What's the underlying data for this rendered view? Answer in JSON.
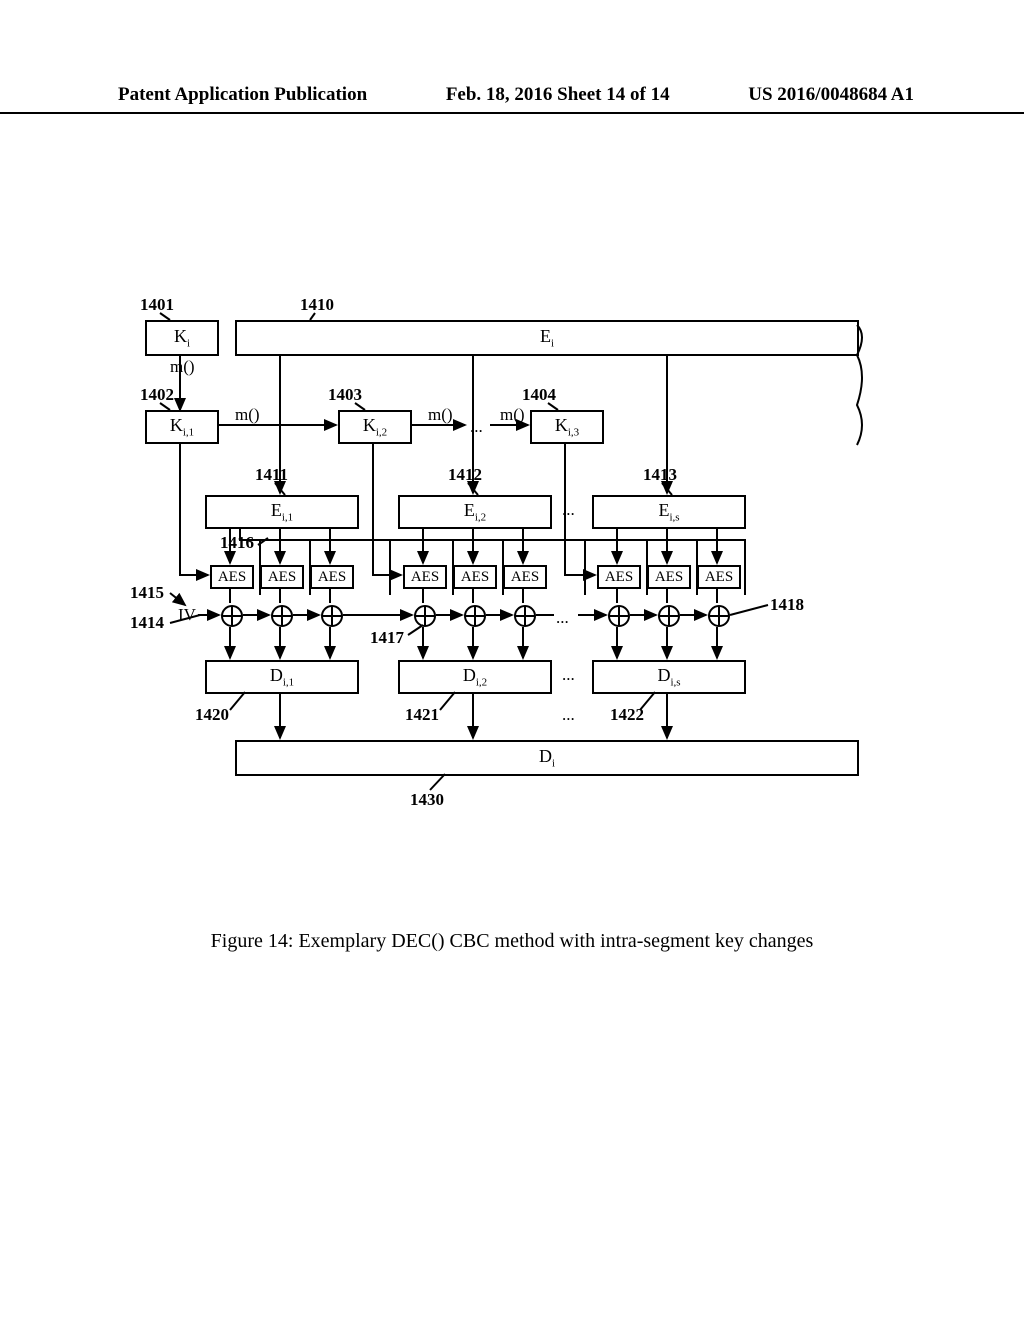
{
  "header": {
    "left": "Patent Application Publication",
    "center": "Feb. 18, 2016  Sheet 14 of 14",
    "right": "US 2016/0048684 A1"
  },
  "labels": {
    "n1401": "1401",
    "n1410": "1410",
    "n1402": "1402",
    "n1403": "1403",
    "n1404": "1404",
    "n1411": "1411",
    "n1412": "1412",
    "n1413": "1413",
    "n1414": "1414",
    "n1415": "1415",
    "n1416": "1416",
    "n1417": "1417",
    "n1418": "1418",
    "n1420": "1420",
    "n1421": "1421",
    "n1422": "1422",
    "n1430": "1430",
    "m": "m()",
    "iv": "IV",
    "dots": "...",
    "aes": "AES"
  },
  "boxes": {
    "Ki": "K<sub class='sub'>i</sub>",
    "Ei": "E<sub class='sub'>i</sub>",
    "Ki1": "K<sub class='sub'>i,1</sub>",
    "Ki2": "K<sub class='sub'>i,2</sub>",
    "Ki3": "K<sub class='sub'>i,3</sub>",
    "Ei1": "E<sub class='sub'>i,1</sub>",
    "Ei2": "E<sub class='sub'>i,2</sub>",
    "Eis": "E<sub class='sub'>i,s</sub>",
    "Di1": "D<sub class='sub'>i,1</sub>",
    "Di2": "D<sub class='sub'>i,2</sub>",
    "Dis": "D<sub class='sub'>i,s</sub>",
    "Di": "D<sub class='sub'>i</sub>"
  },
  "caption": "Figure 14: Exemplary DEC() CBC method with intra-segment key changes"
}
